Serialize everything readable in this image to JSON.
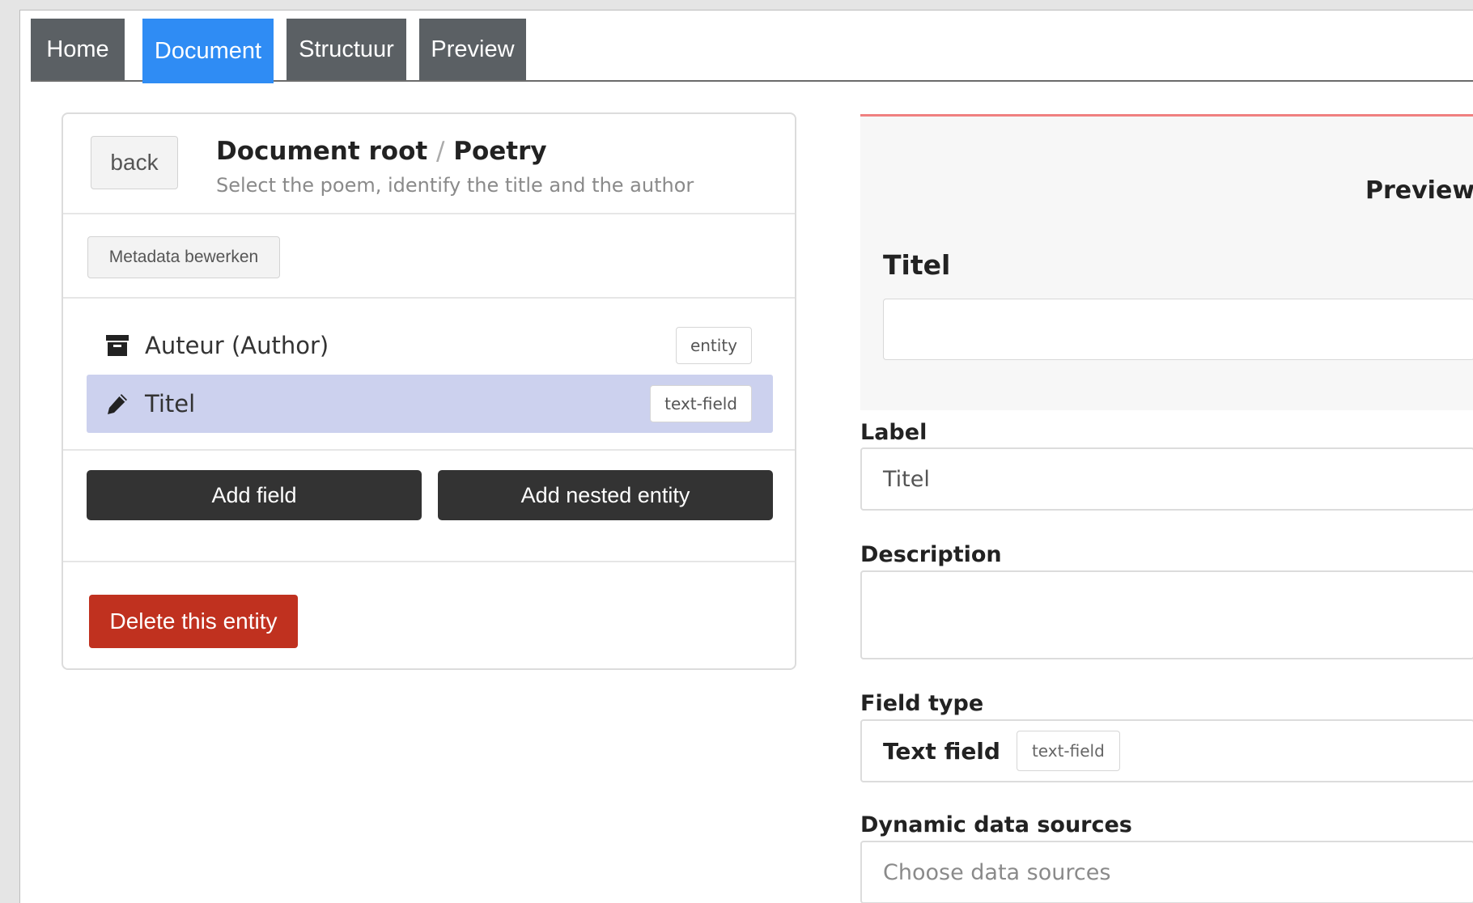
{
  "tabs": [
    {
      "label": "Home",
      "active": false
    },
    {
      "label": "Document",
      "active": true
    },
    {
      "label": "Structuur",
      "active": false
    },
    {
      "label": "Preview",
      "active": false
    }
  ],
  "entity_panel": {
    "back_label": "back",
    "breadcrumb": {
      "root": "Document root",
      "separator": "/",
      "current": "Poetry"
    },
    "description": "Select the poem, identify the title and the author",
    "metadata_button": "Metadata bewerken",
    "items": [
      {
        "icon": "archive-icon",
        "label": "Auteur (Author)",
        "badge": "entity",
        "selected": false
      },
      {
        "icon": "pencil-icon",
        "label": "Titel",
        "badge": "text-field",
        "selected": true
      }
    ],
    "add_field_label": "Add field",
    "add_nested_entity_label": "Add nested entity",
    "delete_label": "Delete this entity"
  },
  "field_editor": {
    "preview_heading": "Preview",
    "preview_field_label": "Titel",
    "label_heading": "Label",
    "label_value": "Titel",
    "description_heading": "Description",
    "description_value": "",
    "field_type_heading": "Field type",
    "field_type_name": "Text field",
    "field_type_badge": "text-field",
    "data_sources_heading": "Dynamic data sources",
    "data_sources_placeholder": "Choose data sources"
  },
  "colors": {
    "tab_bg": "#5b6064",
    "tab_active": "#2f8cf4",
    "selected_row": "#ccd1ee",
    "danger": "#c0311f",
    "dark_button": "#333333",
    "preview_accent": "#f08080"
  }
}
